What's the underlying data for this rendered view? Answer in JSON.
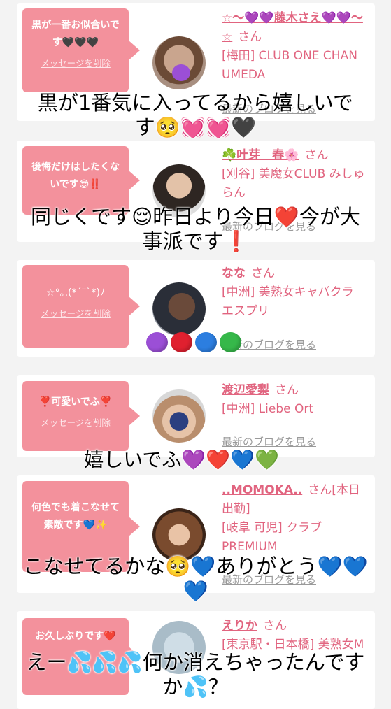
{
  "colors": {
    "accent": "#e1647f",
    "bubble": "#f3919c",
    "blog_link": "#9a9a9a",
    "background": "#f3f3f3"
  },
  "cards": [
    {
      "message": "黒が一番お似合いです🖤🖤🖤",
      "delete_label": "メッセージを削除",
      "name": "☆〜💜💜藤木さえ💜💜〜☆",
      "suffix": "さん",
      "shop": "[梅田] CLUB ONE CHAN UMEDA",
      "blog_label": "最新のブログを見る"
    },
    {
      "message": "後悔だけはしたくないです😎‼️",
      "delete_label": "メッセージを削除",
      "name": "☘️叶芽　春🌸",
      "suffix": "さん",
      "shop": "[刈谷] 美魔女CLUB みしゅらん",
      "blog_label": "最新のブログを見る"
    },
    {
      "message": "☆°｡.(*ˊ˘ˋ*)ﾉ",
      "delete_label": "メッセージを削除",
      "name": "なな",
      "suffix": "さん",
      "shop": "[中洲] 美熟女キャバクラ エスプリ",
      "blog_label": "最新のブログを見る"
    },
    {
      "message": "❣️可愛いでふ❣️",
      "delete_label": "メッセージを削除",
      "name": "渡辺愛梨",
      "suffix": "さん",
      "shop": "[中洲] Liebe Ort",
      "blog_label": "最新のブログを見る"
    },
    {
      "message": "何色でも着こなせて素敵です💙✨",
      "delete_label": "メッセージを削除",
      "name": "..MOMOKA..",
      "suffix": "さん[本日出勤]",
      "shop": "[岐阜 可児] クラブ PREMIUM",
      "blog_label": "最新のブログを見る"
    },
    {
      "message": "お久しぶりです❤️",
      "delete_label": "メッセージを削除",
      "name": "えりか",
      "suffix": "さん",
      "shop": "[東京駅・日本橋] 美熟女M",
      "blog_label": ""
    }
  ],
  "captions": [
    {
      "line1": "黒が1番気に入ってるから嬉しいで",
      "line2": "す🥺💓💓🖤"
    },
    {
      "line1": "同じくです😌昨日より今日❤️今が大",
      "line2": "事派です❗️"
    },
    {
      "line1": "嬉しいでふ💜❤️💙💚",
      "line2": ""
    },
    {
      "line1": "こなせてるかな🥺💙ありがとう💙💙",
      "line2": "💙"
    },
    {
      "line1": "えー💦💦💦何か消えちゃったんです",
      "line2": "か💦？"
    }
  ],
  "heart_colors": [
    "#9b4fd6",
    "#e0202f",
    "#2c7ee0",
    "#36b84a"
  ]
}
